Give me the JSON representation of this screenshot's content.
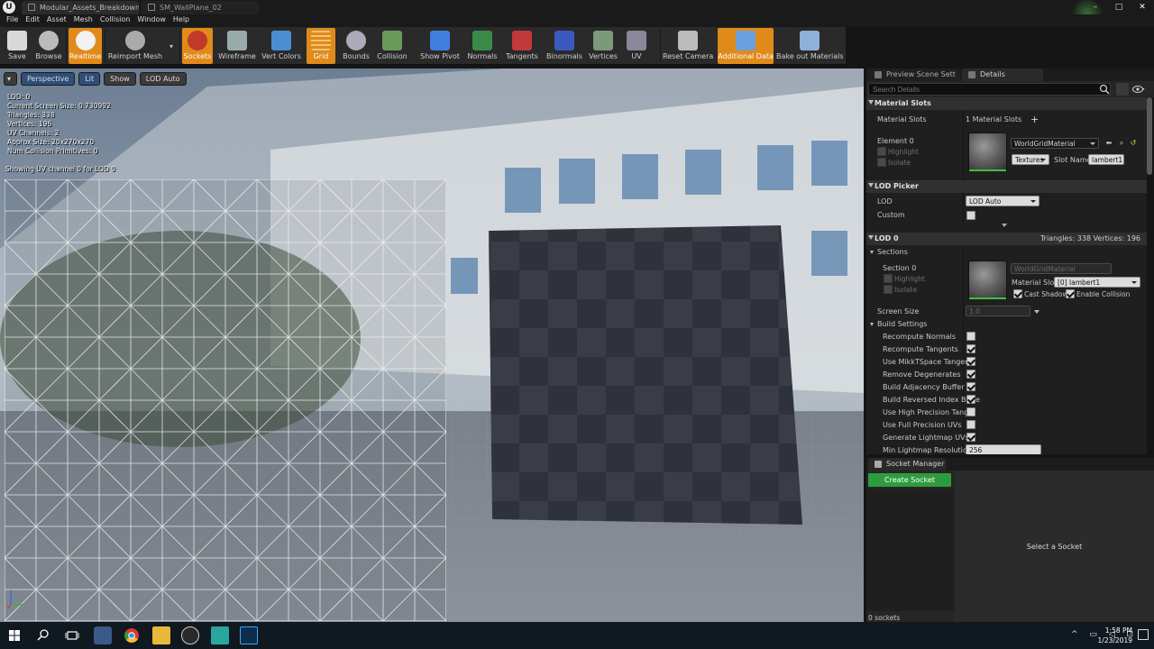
{
  "window": {
    "tabs": [
      "Modular_Assets_Breakdown•",
      "SM_WallPlane_02"
    ],
    "controls": [
      "–",
      "□",
      "✕"
    ]
  },
  "menu": [
    "File",
    "Edit",
    "Asset",
    "Mesh",
    "Collision",
    "Window",
    "Help"
  ],
  "toolbar": [
    {
      "label": "Save",
      "icon": "save-icon",
      "active": false
    },
    {
      "label": "Browse",
      "icon": "browse-icon",
      "active": false
    },
    {
      "label": "Realtime",
      "icon": "realtime-icon",
      "active": true
    },
    {
      "label": "Reimport Mesh",
      "icon": "reimport-icon",
      "active": false
    },
    {
      "label": "Sockets",
      "icon": "sockets-icon",
      "active": true
    },
    {
      "label": "Wireframe",
      "icon": "wireframe-icon",
      "active": false
    },
    {
      "label": "Vert Colors",
      "icon": "vert-colors-icon",
      "active": false
    },
    {
      "label": "Grid",
      "icon": "grid-icon",
      "active": true
    },
    {
      "label": "Bounds",
      "icon": "bounds-icon",
      "active": false
    },
    {
      "label": "Collision",
      "icon": "collision-icon",
      "active": false
    },
    {
      "label": "Show Pivot",
      "icon": "pivot-icon",
      "active": false
    },
    {
      "label": "Normals",
      "icon": "normals-icon",
      "active": false
    },
    {
      "label": "Tangents",
      "icon": "tangents-icon",
      "active": false
    },
    {
      "label": "Binormals",
      "icon": "binormals-icon",
      "active": false
    },
    {
      "label": "Vertices",
      "icon": "vertices-icon",
      "active": false
    },
    {
      "label": "UV",
      "icon": "uv-icon",
      "active": false
    },
    {
      "label": "Reset Camera",
      "icon": "camera-icon",
      "active": false
    },
    {
      "label": "Additional Data",
      "icon": "additional-data-icon",
      "active": true
    },
    {
      "label": "Bake out Materials",
      "icon": "bake-materials-icon",
      "active": false
    }
  ],
  "viewport": {
    "buttons": [
      "Perspective",
      "Lit",
      "Show",
      "LOD Auto"
    ],
    "stats": [
      "LOD:  0",
      "Current Screen Size:  0.730992",
      "Triangles:  338",
      "Vertices:  196",
      "UV Channels:  2",
      "Approx Size: 20x270x270",
      "Num Collision Primitives:  0"
    ],
    "uv_caption": "Showing UV channel 0 for LOD 0"
  },
  "panel_tabs": [
    "Preview Scene Sett",
    "Details"
  ],
  "search": {
    "placeholder": "Search Details"
  },
  "details": {
    "material_slots": {
      "header": "Material Slots",
      "label": "Material Slots",
      "count": "1 Material Slots",
      "add": "+",
      "element": "Element 0",
      "highlight": "Highlight",
      "isolate": "Isolate",
      "material": "WorldGridMaterial",
      "textures": "Textures",
      "slot_name_label": "Slot Name",
      "slot_name": "lambert1"
    },
    "lod_picker": {
      "header": "LOD Picker",
      "lod_label": "LOD",
      "lod_value": "LOD Auto",
      "custom_label": "Custom"
    },
    "lod0": {
      "header": "LOD 0",
      "stats": "Triangles: 338   Vertices: 196",
      "sections": "Sections",
      "section": "Section 0",
      "highlight": "Highlight",
      "isolate": "Isolate",
      "material": "WorldGridMaterial",
      "material_slot_label": "Material Slot",
      "material_slot_value": "[0] lambert1",
      "cast_shadow": "Cast Shadow",
      "enable_collision": "Enable Collision",
      "screen_size_label": "Screen Size",
      "screen_size_value": "1.0",
      "build_settings": "Build Settings",
      "build_items": [
        {
          "label": "Recompute Normals",
          "checked": false
        },
        {
          "label": "Recompute Tangents",
          "checked": true
        },
        {
          "label": "Use MikkTSpace Tangent",
          "checked": true
        },
        {
          "label": "Remove Degenerates",
          "checked": true
        },
        {
          "label": "Build Adjacency Buffer",
          "checked": true
        },
        {
          "label": "Build Reversed Index Buffe",
          "checked": true
        },
        {
          "label": "Use High Precision Tanger",
          "checked": false
        },
        {
          "label": "Use Full Precision UVs",
          "checked": false
        },
        {
          "label": "Generate Lightmap UVs",
          "checked": true
        }
      ],
      "min_lightmap_label": "Min Lightmap Resolution",
      "min_lightmap_value": "256"
    }
  },
  "socket_manager": {
    "tab": "Socket Manager",
    "create": "Create Socket",
    "count": "0 sockets",
    "empty": "Select a Socket"
  },
  "taskbar": {
    "time": "1:58 PM",
    "date": "1/23/2019",
    "tray": "^ ▭ ◁ ⊡"
  },
  "colors": {
    "accent_orange": "#e08a1a",
    "create_green": "#2e9c3e",
    "editor_bg": "#262626"
  }
}
